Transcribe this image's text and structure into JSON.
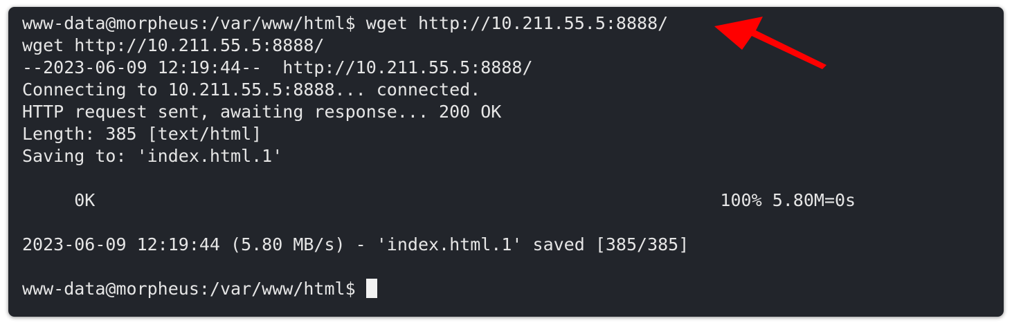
{
  "terminal": {
    "lines": [
      "www-data@morpheus:/var/www/html$ wget http://10.211.55.5:8888/",
      "wget http://10.211.55.5:8888/",
      "--2023-06-09 12:19:44--  http://10.211.55.5:8888/",
      "Connecting to 10.211.55.5:8888... connected.",
      "HTTP request sent, awaiting response... 200 OK",
      "Length: 385 [text/html]",
      "Saving to: 'index.html.1'",
      "",
      "     0K                                                            100% 5.80M=0s",
      "",
      "2023-06-09 12:19:44 (5.80 MB/s) - 'index.html.1' saved [385/385]",
      "",
      "www-data@morpheus:/var/www/html$ "
    ]
  },
  "annotation": {
    "arrow_color": "#ff0000"
  },
  "colors": {
    "background": "#22252b",
    "text": "#e6e6e6",
    "cursor": "#f2f2f2"
  }
}
